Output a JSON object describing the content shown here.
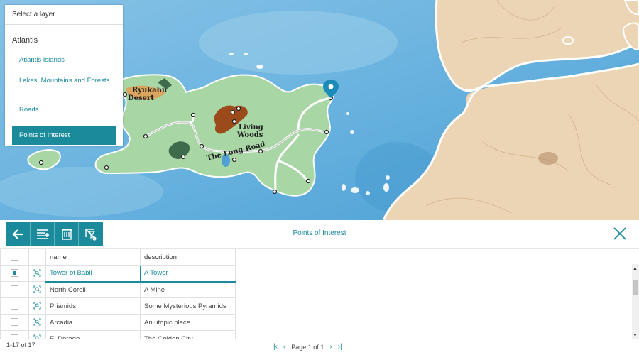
{
  "layer_panel": {
    "header": "Select a layer",
    "group_title": "Atlantis",
    "items": [
      {
        "label": "Atlantis Islands",
        "active": false
      },
      {
        "label": "Lakes, Mountains and Forests",
        "active": false
      },
      {
        "label": "Roads",
        "active": false
      },
      {
        "label": "Points of Interest",
        "active": true
      }
    ]
  },
  "map": {
    "labels": {
      "desert_line1": "Ryukahn",
      "desert_line2": "Desert",
      "woods_line1": "Living",
      "woods_line2": "Woods",
      "road": "The Long Road"
    },
    "marker": "map-pin-icon"
  },
  "toolbar": {
    "title": "Points of Interest",
    "buttons": [
      "back-arrow-icon",
      "add-column-icon",
      "delete-icon",
      "clear-filter-icon"
    ],
    "close": "close-icon"
  },
  "grid": {
    "columns": [
      "name",
      "description"
    ],
    "rows": [
      {
        "name": "Tower of Babil",
        "description": "A Tower",
        "checked": true
      },
      {
        "name": "North Corell",
        "description": "A Mine",
        "checked": false
      },
      {
        "name": "Priamids",
        "description": "Some Mysterious Pyramids",
        "checked": false
      },
      {
        "name": "Arcadia",
        "description": "An utopic place",
        "checked": false
      },
      {
        "name": "El Dorado",
        "description": "The Golden City",
        "checked": false
      }
    ]
  },
  "footer": {
    "count": "1-17 of 17",
    "page_text": "Page 1 of 1",
    "first": "|‹",
    "prev": "‹",
    "next": "›",
    "last": "›|"
  },
  "colors": {
    "accent": "#1b8b9b",
    "sea": "#52a6d6",
    "island": "#a8d5a2",
    "land": "#ead3b3"
  }
}
